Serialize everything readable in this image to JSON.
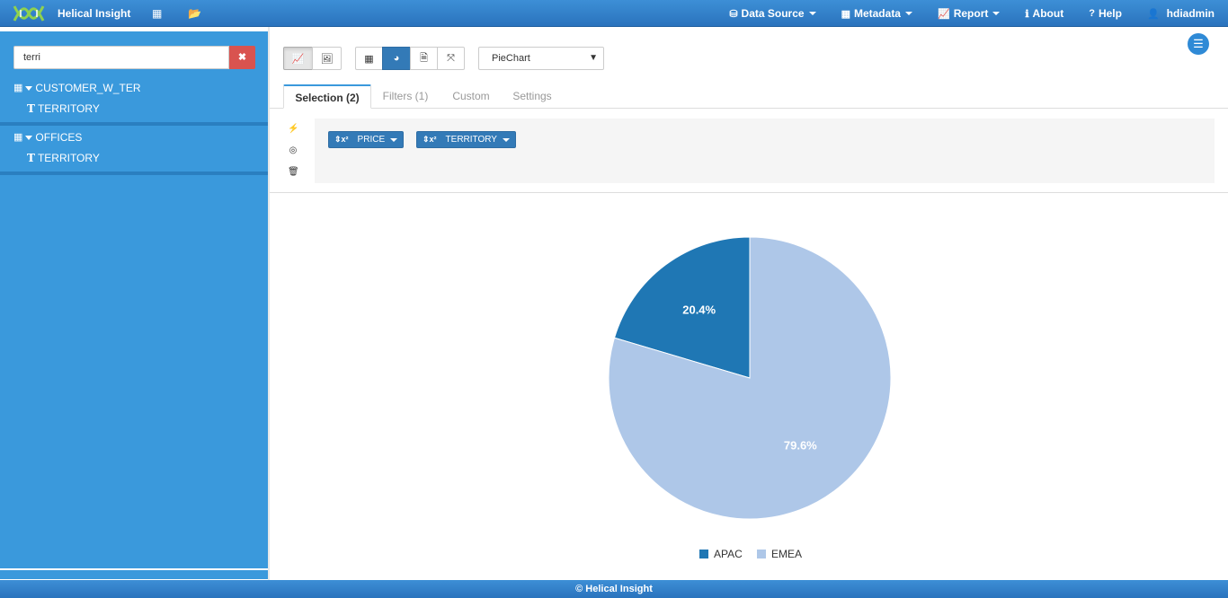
{
  "app": {
    "brand": "Helical Insight",
    "brand_color": "#2f82cc"
  },
  "nav": {
    "datasource_label": "Data Source",
    "metadata_label": "Metadata",
    "report_label": "Report",
    "about_label": "About",
    "help_label": "Help",
    "user_label": "hdiadmin"
  },
  "sidebar": {
    "search_value": "terri",
    "tables": [
      {
        "name": "CUSTOMER_W_TER",
        "columns": [
          "TERRITORY"
        ]
      },
      {
        "name": "OFFICES",
        "columns": [
          "TERRITORY"
        ]
      }
    ]
  },
  "toolbar": {
    "chart_type_selected": "PieChart"
  },
  "tabs": [
    {
      "label": "Selection (2)",
      "active": true
    },
    {
      "label": "Filters (1)",
      "active": false
    },
    {
      "label": "Custom",
      "active": false
    },
    {
      "label": "Settings",
      "active": false
    }
  ],
  "selection": {
    "fields": [
      {
        "label": "PRICE"
      },
      {
        "label": "TERRITORY"
      }
    ]
  },
  "chart_data": {
    "type": "pie",
    "categories": [
      "APAC",
      "EMEA"
    ],
    "values": [
      20.4,
      79.6
    ],
    "labels": [
      "20.4%",
      "79.6%"
    ],
    "colors": [
      "#1f77b4",
      "#aec7e8"
    ],
    "legend": "bottom"
  },
  "footer": {
    "text": "© Helical Insight"
  }
}
